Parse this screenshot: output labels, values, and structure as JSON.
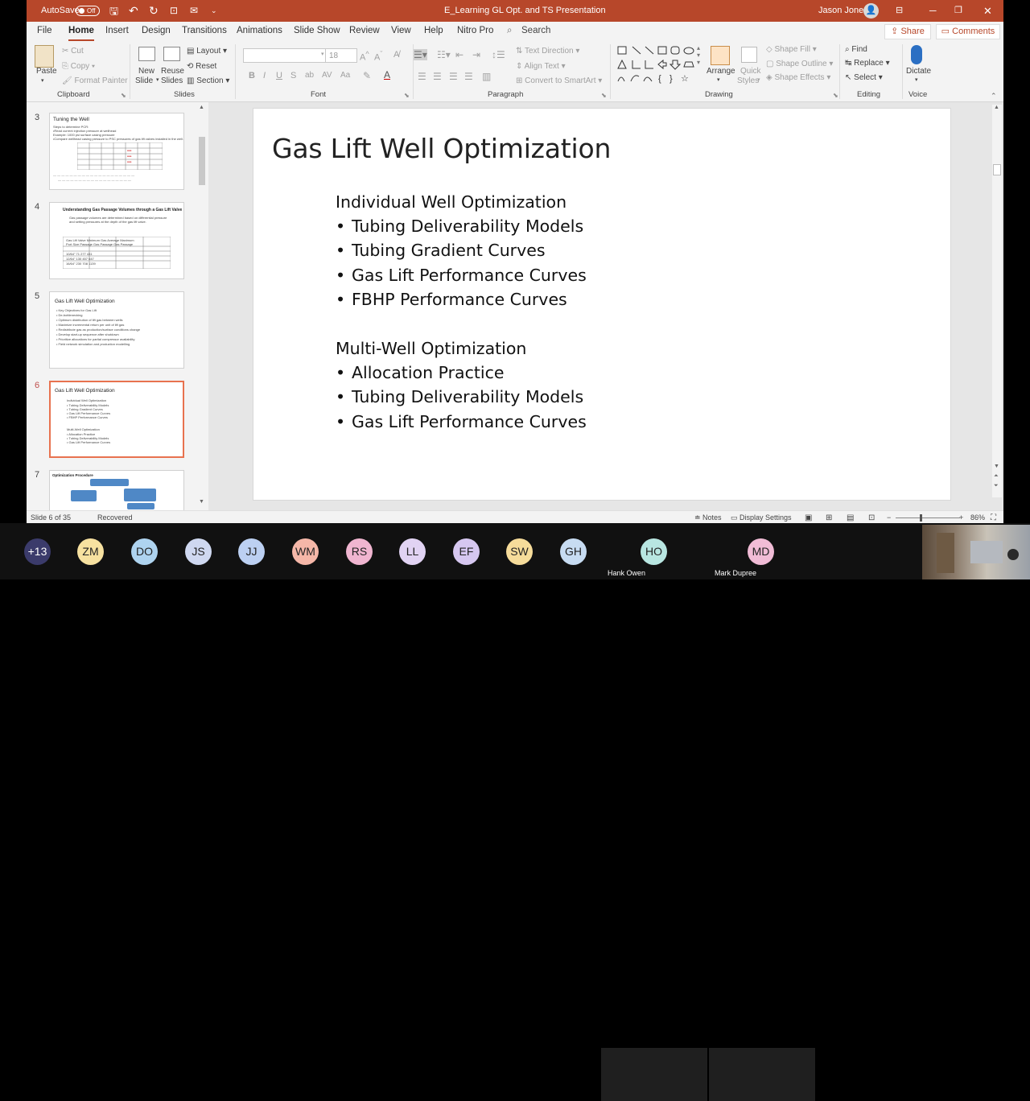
{
  "titlebar": {
    "autosave": "AutoSave",
    "toggle": "Off",
    "doc": "E_Learning GL Opt. and TS Presentation",
    "user": "Jason Jones",
    "user_initials": "JJ"
  },
  "tabs": [
    "File",
    "Home",
    "Insert",
    "Design",
    "Transitions",
    "Animations",
    "Slide Show",
    "Review",
    "View",
    "Help",
    "Nitro Pro"
  ],
  "search_label": "Search",
  "share": "Share",
  "comments": "Comments",
  "ribbon": {
    "clipboard": {
      "paste": "Paste",
      "cut": "Cut",
      "copy": "Copy",
      "format_painter": "Format Painter",
      "label": "Clipboard"
    },
    "slides": {
      "new_slide": [
        "New",
        "Slide"
      ],
      "reuse_slides": [
        "Reuse",
        "Slides"
      ],
      "layout": "Layout",
      "reset": "Reset",
      "section": "Section",
      "label": "Slides"
    },
    "font": {
      "size": "18",
      "label": "Font"
    },
    "paragraph": {
      "text_direction": "Text Direction",
      "align_text": "Align Text",
      "smartart": "Convert to SmartArt",
      "label": "Paragraph"
    },
    "drawing": {
      "arrange": "Arrange",
      "quick_styles": [
        "Quick",
        "Styles"
      ],
      "shape_fill": "Shape Fill",
      "shape_outline": "Shape Outline",
      "shape_effects": "Shape Effects",
      "label": "Drawing"
    },
    "editing": {
      "find": "Find",
      "replace": "Replace",
      "select": "Select",
      "label": "Editing"
    },
    "voice": {
      "dictate": "Dictate",
      "label": "Voice"
    }
  },
  "thumbnails": [
    {
      "num": "3",
      "title": "Tuning the Well",
      "lines": [
        "Steps to determine PCR:",
        "•Read current injection pressure at wellhead",
        "   Example: 1000 psi surface casing pressure",
        "•Compare wellhead casing pressure to PSC pressures of gas lift valves installed in the well."
      ]
    },
    {
      "num": "4",
      "title": "Understanding Gas Passage Volumes through a Gas Lift Valve",
      "lines": [
        "Gas passage volumes are determined based on differential pressure",
        "and setting pressures at the depth of the gas lift valve.",
        "Gas Lift Valve  Minimum Gas  Average  Maximum",
        "Port Size  Passage  Gas Passage  Gas Passage",
        "10/64\"  71  277  431",
        "12/64\"  130  457  647",
        "16/64\"  230  708  1139"
      ]
    },
    {
      "num": "5",
      "title": "Gas Lift Well Optimization",
      "lines": [
        "• Key Objectives for Gas Lift",
        "   • De-bottlenecking",
        "   • Optimum distribution of lift gas between wells",
        "   • Maximize incremental return per unit of lift gas",
        "   • Redistribute gas as production/surface conditions change",
        "   • Develop start-up sequence after shutdown",
        "   • Prioritize allocations for partial compressor availability",
        "   • Field network simulation and production modelling"
      ]
    },
    {
      "num": "6",
      "title": "Gas Lift Well Optimization",
      "lines": [
        "Individual Well Optimization",
        "  • Tubing Deliverability Models",
        "  • Tubing Gradient Curves",
        "  • Gas Lift Performance Curves",
        "  • FBHP Performance Curves",
        "",
        "Multi-Well Optimization",
        "  • Allocation Practice",
        "  • Tubing Deliverability Models",
        "  • Gas Lift Performance Curves"
      ]
    },
    {
      "num": "7",
      "title": "Optimization Procedure",
      "lines": []
    }
  ],
  "slide": {
    "title": "Gas Lift Well Optimization",
    "section1": "Individual Well Optimization",
    "bullets1": [
      "Tubing Deliverability Models",
      "Tubing Gradient Curves",
      "Gas Lift Performance Curves",
      "FBHP Performance Curves"
    ],
    "section2": "Multi-Well Optimization",
    "bullets2": [
      "Allocation Practice",
      "Tubing Deliverability Models",
      "Gas Lift Performance Curves"
    ]
  },
  "status": {
    "slide": "Slide 6 of 35",
    "recovered": "Recovered",
    "notes": "Notes",
    "display": "Display Settings",
    "zoom": "86%"
  },
  "participants": [
    {
      "initials": "+13",
      "color": "#3b3b6b"
    },
    {
      "initials": "ZM",
      "color": "#f7e1a0"
    },
    {
      "initials": "DO",
      "color": "#aed3ef"
    },
    {
      "initials": "JS",
      "color": "#cfd8f0"
    },
    {
      "initials": "JJ",
      "color": "#bcd0f2"
    },
    {
      "initials": "WM",
      "color": "#f5b7a8"
    },
    {
      "initials": "RS",
      "color": "#f0b5d0"
    },
    {
      "initials": "LL",
      "color": "#e1d3f3"
    },
    {
      "initials": "EF",
      "color": "#d6c7f0"
    },
    {
      "initials": "SW",
      "color": "#f6dc9a"
    },
    {
      "initials": "GH",
      "color": "#c7dcf2"
    },
    {
      "initials": "HO",
      "color": "#b8e6e1",
      "name": "Hank Owen"
    },
    {
      "initials": "MD",
      "color": "#f1bcd6",
      "name": "Mark Dupree"
    }
  ]
}
